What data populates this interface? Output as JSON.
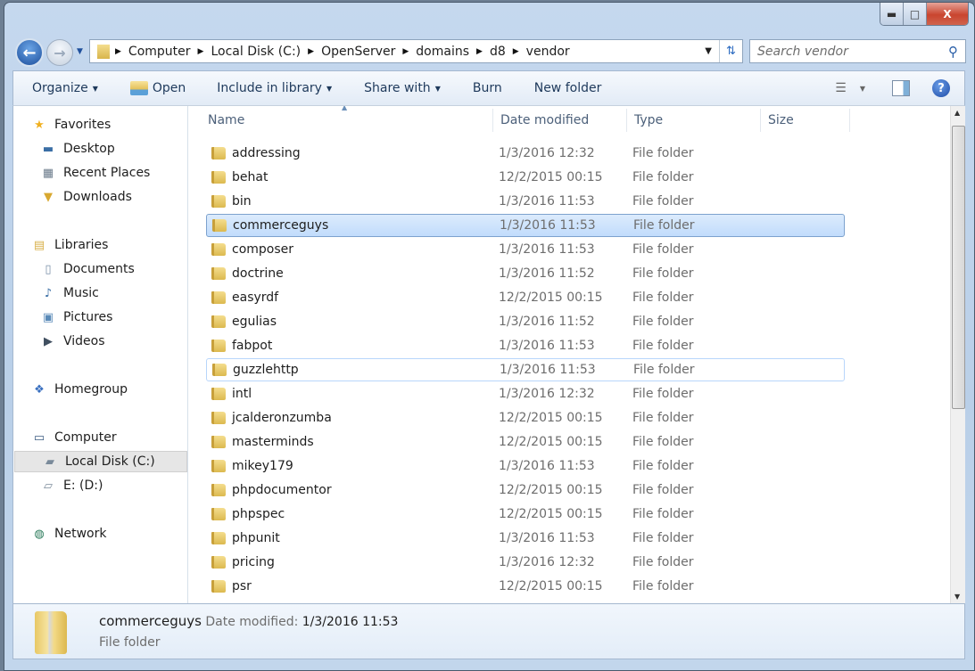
{
  "window": {
    "minimize": "minimize",
    "maximize": "maximize",
    "close": "close"
  },
  "address": {
    "crumbs": [
      "Computer",
      "Local Disk (C:)",
      "OpenServer",
      "domains",
      "d8",
      "vendor"
    ]
  },
  "search": {
    "placeholder": "Search vendor"
  },
  "toolbar": {
    "organize": "Organize",
    "open": "Open",
    "include": "Include in library",
    "share": "Share with",
    "burn": "Burn",
    "new_folder": "New folder"
  },
  "nav": {
    "items": [
      {
        "label": "Favorites",
        "icon": "star-icon",
        "level": 0
      },
      {
        "label": "Desktop",
        "icon": "desktop-icon",
        "level": 1
      },
      {
        "label": "Recent Places",
        "icon": "recent-places-icon",
        "level": 1
      },
      {
        "label": "Downloads",
        "icon": "downloads-icon",
        "level": 1
      },
      {
        "label": "Libraries",
        "icon": "libraries-icon",
        "level": 0
      },
      {
        "label": "Documents",
        "icon": "documents-icon",
        "level": 1
      },
      {
        "label": "Music",
        "icon": "music-icon",
        "level": 1
      },
      {
        "label": "Pictures",
        "icon": "pictures-icon",
        "level": 1
      },
      {
        "label": "Videos",
        "icon": "videos-icon",
        "level": 1
      },
      {
        "label": "Homegroup",
        "icon": "homegroup-icon",
        "level": 0
      },
      {
        "label": "Computer",
        "icon": "computer-icon",
        "level": 0
      },
      {
        "label": "Local Disk (C:)",
        "icon": "drive-icon",
        "level": 1,
        "selected": true
      },
      {
        "label": "E: (D:)",
        "icon": "removable-drive-icon",
        "level": 1
      },
      {
        "label": "Network",
        "icon": "network-icon",
        "level": 0
      }
    ]
  },
  "columns": {
    "name": "Name",
    "date": "Date modified",
    "type": "Type",
    "size": "Size",
    "sorted": "name-ascending"
  },
  "files": [
    {
      "name": "addressing",
      "date": "1/3/2016 12:32",
      "type": "File folder"
    },
    {
      "name": "behat",
      "date": "12/2/2015 00:15",
      "type": "File folder"
    },
    {
      "name": "bin",
      "date": "1/3/2016 11:53",
      "type": "File folder"
    },
    {
      "name": "commerceguys",
      "date": "1/3/2016 11:53",
      "type": "File folder",
      "state": "selected"
    },
    {
      "name": "composer",
      "date": "1/3/2016 11:53",
      "type": "File folder"
    },
    {
      "name": "doctrine",
      "date": "1/3/2016 11:52",
      "type": "File folder"
    },
    {
      "name": "easyrdf",
      "date": "12/2/2015 00:15",
      "type": "File folder"
    },
    {
      "name": "egulias",
      "date": "1/3/2016 11:52",
      "type": "File folder"
    },
    {
      "name": "fabpot",
      "date": "1/3/2016 11:53",
      "type": "File folder"
    },
    {
      "name": "guzzlehttp",
      "date": "1/3/2016 11:53",
      "type": "File folder",
      "state": "hover"
    },
    {
      "name": "intl",
      "date": "1/3/2016 12:32",
      "type": "File folder"
    },
    {
      "name": "jcalderonzumba",
      "date": "12/2/2015 00:15",
      "type": "File folder"
    },
    {
      "name": "masterminds",
      "date": "12/2/2015 00:15",
      "type": "File folder"
    },
    {
      "name": "mikey179",
      "date": "1/3/2016 11:53",
      "type": "File folder"
    },
    {
      "name": "phpdocumentor",
      "date": "12/2/2015 00:15",
      "type": "File folder"
    },
    {
      "name": "phpspec",
      "date": "12/2/2015 00:15",
      "type": "File folder"
    },
    {
      "name": "phpunit",
      "date": "1/3/2016 11:53",
      "type": "File folder"
    },
    {
      "name": "pricing",
      "date": "1/3/2016 12:32",
      "type": "File folder"
    },
    {
      "name": "psr",
      "date": "12/2/2015 00:15",
      "type": "File folder"
    }
  ],
  "details": {
    "name": "commerceguys",
    "date_label": "Date modified:",
    "date": "1/3/2016 11:53",
    "type": "File folder"
  }
}
